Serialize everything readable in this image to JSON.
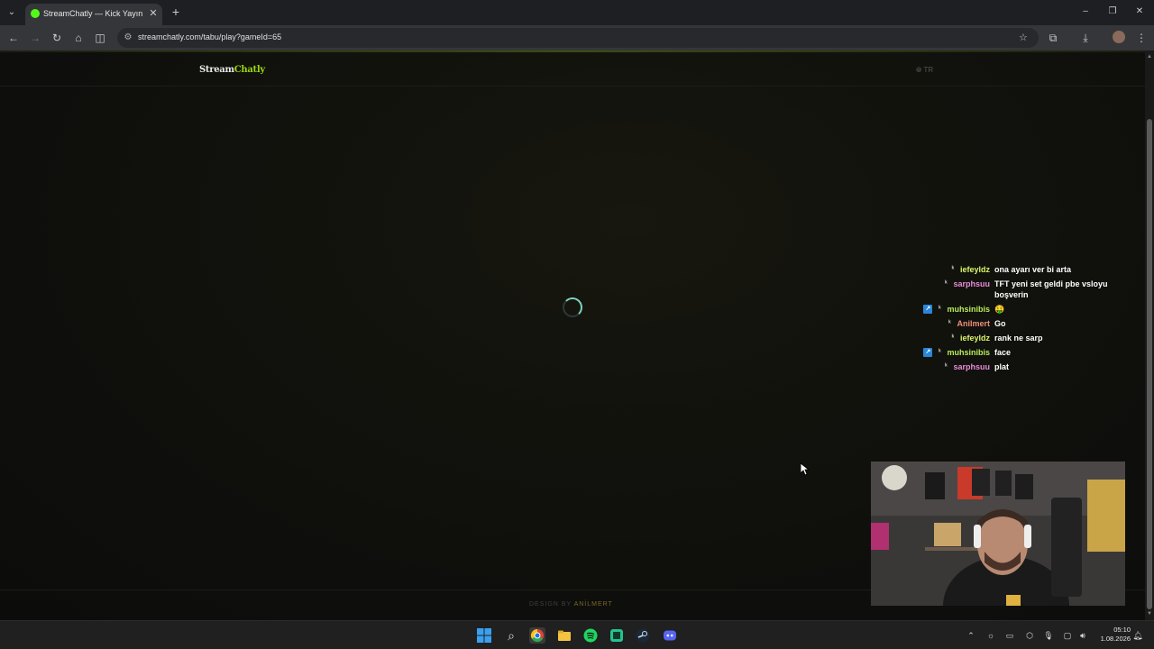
{
  "browser": {
    "tab_title": "StreamChatly — Kick Yayıncıları",
    "tab_close_label": "✕",
    "newtab_label": "+",
    "url": "streamchatly.com/tabu/play?gameId=65"
  },
  "site": {
    "logo_part1": "Stream",
    "logo_part2": "Chatly",
    "lang": "TR",
    "footer_design_by": "DESIGN BY",
    "footer_author": "ANİLMERT"
  },
  "chat": {
    "messages": [
      {
        "user": "iefeyldz",
        "color": "#d9f56a",
        "sub_badge": false,
        "text": "ona ayarı ver bi arta"
      },
      {
        "user": "sarphsuu",
        "color": "#e88ad6",
        "sub_badge": false,
        "text": "TFT yeni set geldi pbe vsloyu boşverin"
      },
      {
        "user": "muhsinibis",
        "color": "#b7ec5a",
        "sub_badge": true,
        "text": "🤑"
      },
      {
        "user": "Anilmert",
        "color": "#ef8f78",
        "sub_badge": false,
        "text": "Go"
      },
      {
        "user": "iefeyldz",
        "color": "#d9f56a",
        "sub_badge": false,
        "text": "rank ne sarp"
      },
      {
        "user": "muhsinibis",
        "color": "#b7ec5a",
        "sub_badge": true,
        "text": "face"
      },
      {
        "user": "sarphsuu",
        "color": "#e88ad6",
        "sub_badge": false,
        "text": "plat"
      }
    ]
  },
  "taskbar": {
    "clock_time": "05:10",
    "clock_date": "1.08.2026"
  },
  "colors": {
    "accent": "#9ad60e",
    "spinner": "#7fd3c3",
    "kick_green": "#53fc18"
  }
}
